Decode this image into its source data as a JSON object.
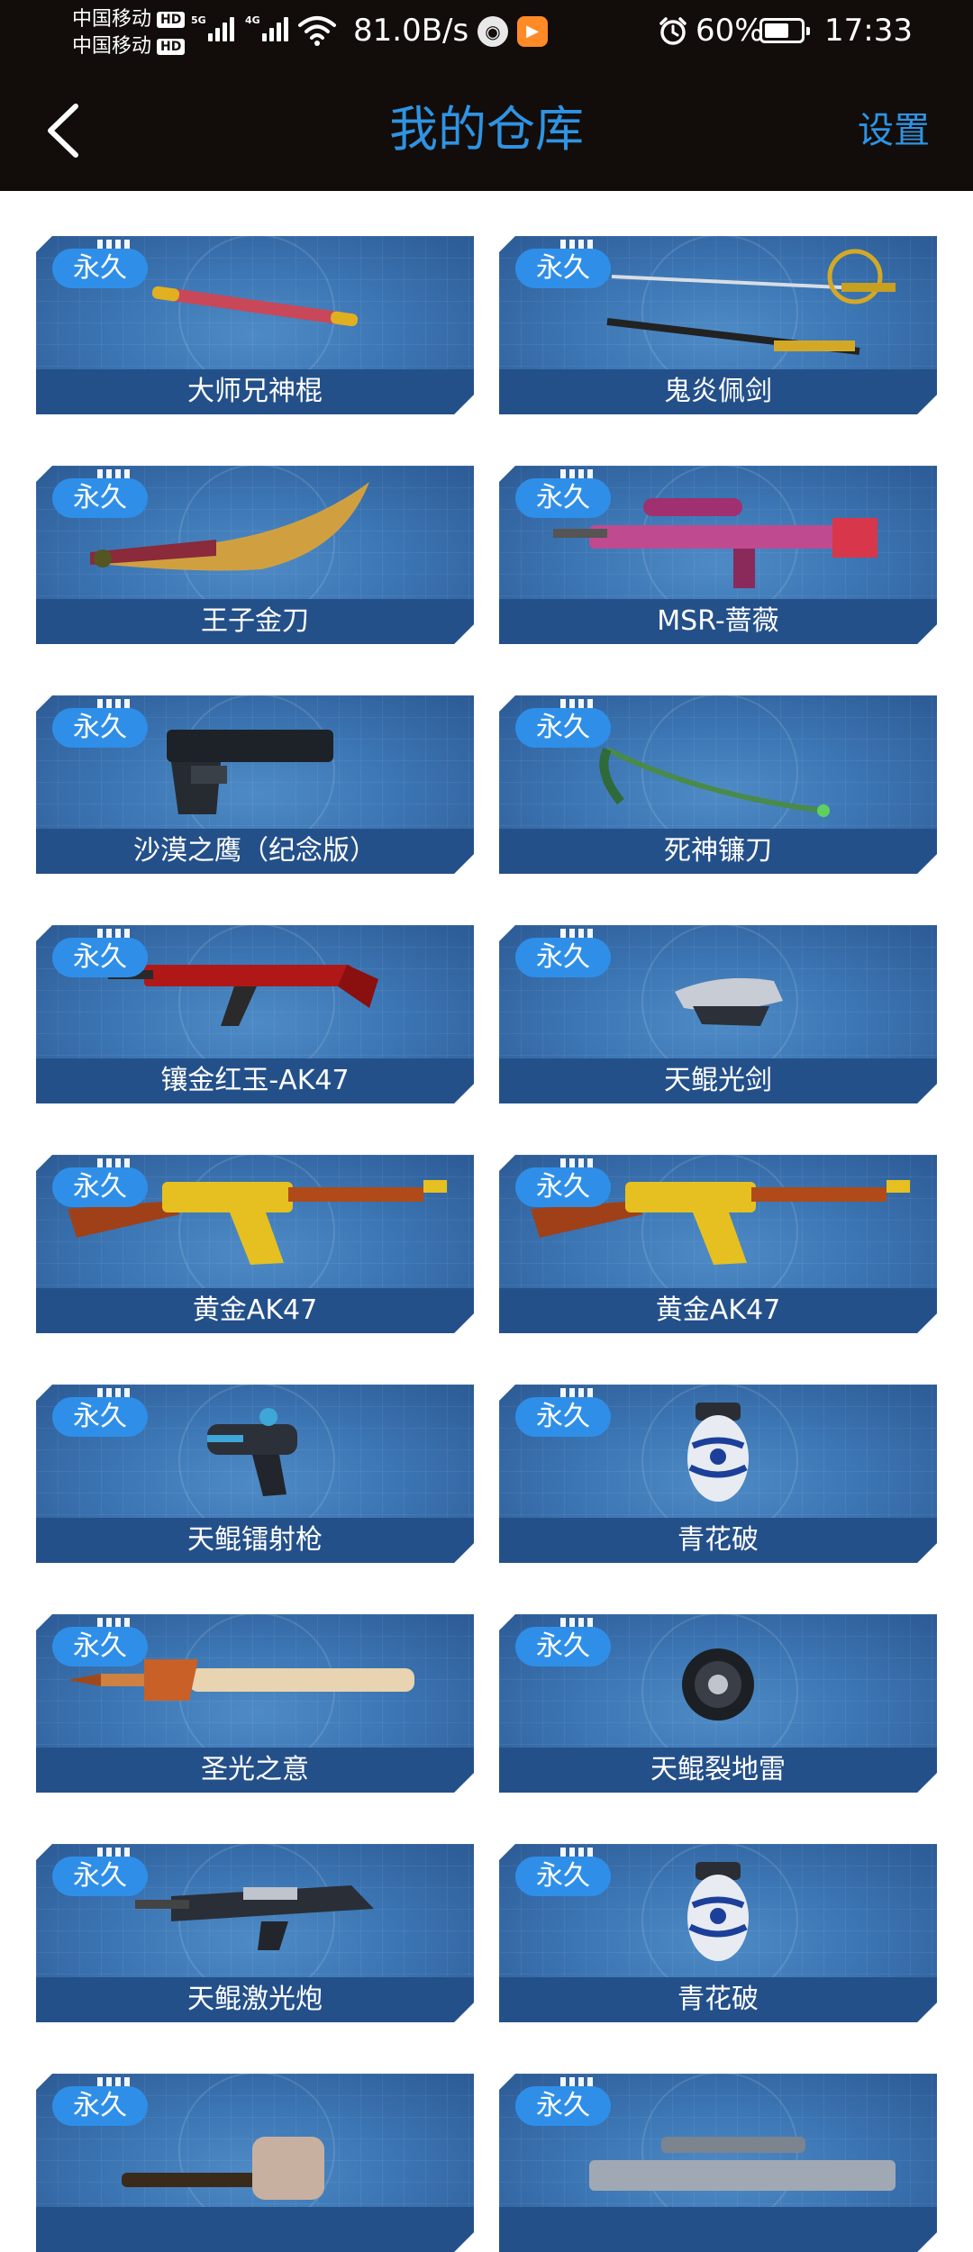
{
  "status_bar": {
    "carrier_1": "中国移动",
    "carrier_2": "中国移动",
    "hd": "HD",
    "sig1_tag": "5G",
    "sig2_tag": "4G",
    "net_speed": "81.0B/s",
    "battery": "60%",
    "time": "17:33"
  },
  "header": {
    "title": "我的仓库",
    "settings": "设置"
  },
  "colors": {
    "accent": "#2f93e3",
    "card_bg": "#3c76b4",
    "name_bar": "#24508a",
    "badge": "#2f8fe8"
  },
  "items": [
    {
      "badge": "永久",
      "name": "大师兄神棍",
      "icon": "staff-icon"
    },
    {
      "badge": "永久",
      "name": "鬼炎佩剑",
      "icon": "saber-icon"
    },
    {
      "badge": "永久",
      "name": "王子金刀",
      "icon": "golden-blade-icon"
    },
    {
      "badge": "永久",
      "name": "MSR-蔷薇",
      "icon": "sniper-rifle-icon"
    },
    {
      "badge": "永久",
      "name": "沙漠之鹰（纪念版）",
      "icon": "pistol-icon"
    },
    {
      "badge": "永久",
      "name": "死神镰刀",
      "icon": "scythe-icon"
    },
    {
      "badge": "永久",
      "name": "镶金红玉-AK47",
      "icon": "rifle-icon"
    },
    {
      "badge": "永久",
      "name": "天鲲光剑",
      "icon": "light-sword-icon"
    },
    {
      "badge": "永久",
      "name": "黄金AK47",
      "icon": "gold-rifle-icon"
    },
    {
      "badge": "永久",
      "name": "黄金AK47",
      "icon": "gold-rifle-icon"
    },
    {
      "badge": "永久",
      "name": "天鲲镭射枪",
      "icon": "laser-gun-icon"
    },
    {
      "badge": "永久",
      "name": "青花破",
      "icon": "grenade-icon"
    },
    {
      "badge": "永久",
      "name": "圣光之意",
      "icon": "holy-sword-icon"
    },
    {
      "badge": "永久",
      "name": "天鲲裂地雷",
      "icon": "mine-icon"
    },
    {
      "badge": "永久",
      "name": "天鲲激光炮",
      "icon": "laser-cannon-icon"
    },
    {
      "badge": "永久",
      "name": "青花破",
      "icon": "grenade-icon"
    },
    {
      "badge": "永久",
      "name": "",
      "icon": "hammer-icon"
    },
    {
      "badge": "永久",
      "name": "",
      "icon": "heavy-rifle-icon"
    }
  ]
}
